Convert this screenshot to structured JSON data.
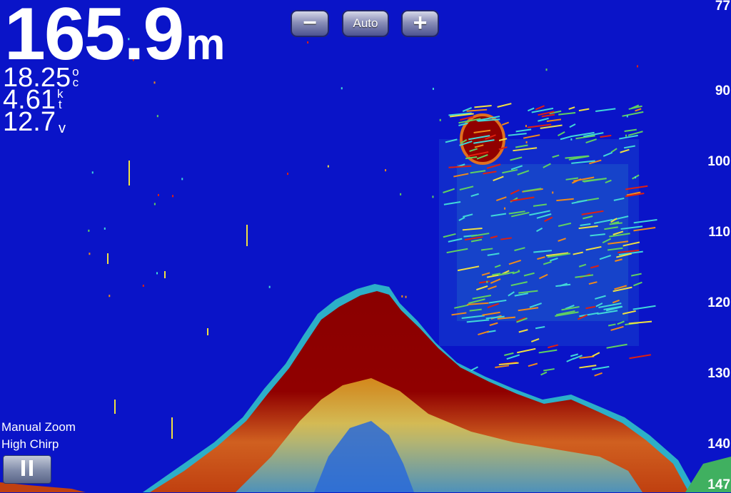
{
  "readouts": {
    "depth_value": "165.9",
    "depth_unit": "m",
    "temperature_value": "18.25",
    "temperature_unit": [
      "o",
      "c"
    ],
    "speed_value": "4.61",
    "speed_unit": [
      "k",
      "t"
    ],
    "voltage_value": "12.7",
    "voltage_unit": "v"
  },
  "zoom_controls": {
    "minus_icon": "minus-icon",
    "auto_label": "Auto",
    "plus_icon": "plus-icon"
  },
  "depth_scale": {
    "ticks": [
      "77",
      "90",
      "100",
      "110",
      "120",
      "130",
      "140",
      "147"
    ]
  },
  "mode": {
    "zoom_label": "Manual Zoom",
    "frequency_label": "High Chirp"
  },
  "pause_button": {
    "icon": "pause-icon"
  },
  "colors": {
    "water": "#0a14c8",
    "strong_return": "#8a0000",
    "red": "#e02010",
    "orange": "#f08a1a",
    "yellow": "#f0e040",
    "green": "#60d060",
    "cyan": "#40d8d8"
  }
}
